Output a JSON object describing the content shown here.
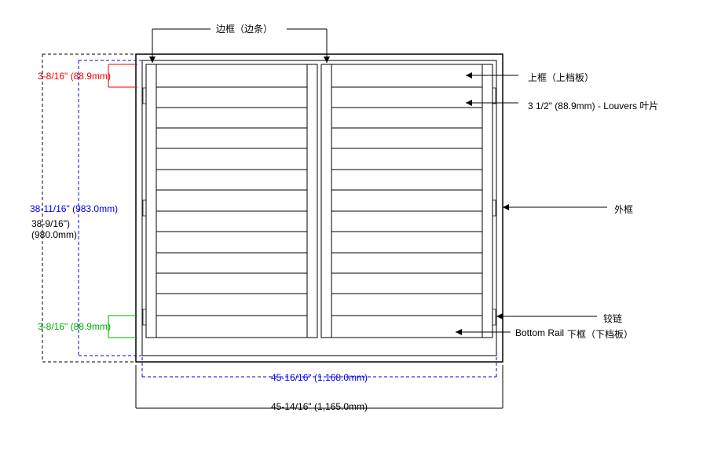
{
  "labels": {
    "stile": "边框（边条）",
    "top_rail": "上框（上档板）",
    "louvers": "3 1/2\" (88.9mm) - Louvers  叶片",
    "outer_frame": "外框",
    "hinge": "铰链",
    "bottom_rail_en": "Bottom Rail",
    "bottom_rail_cn": "下框（下档板）"
  },
  "dims": {
    "top_rail_h": "3-8/16\" (88.9mm)",
    "bottom_rail_h": "3-8/16\" (88.9mm)",
    "inner_h": "38-11/16\" (983.0mm)",
    "outer_h": "38-9/16\")",
    "outer_h2": "(980.0mm)",
    "inner_w": "45-16/16\" (1,168.0mm)",
    "outer_w": "45-14/16\" (1,165.0mm)"
  }
}
